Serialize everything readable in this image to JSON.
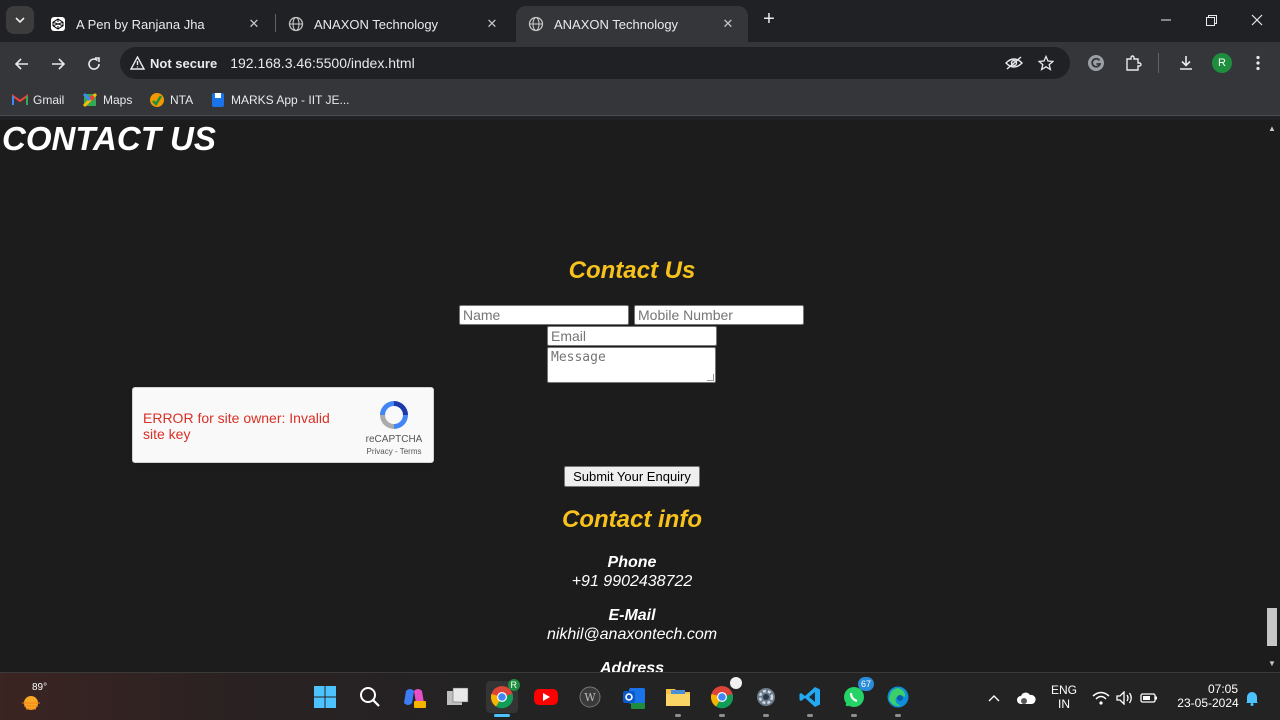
{
  "browser": {
    "tab_search_icon": "chevron-down-icon",
    "tabs": [
      {
        "title": "A Pen by Ranjana Jha",
        "icon": "codepen-icon"
      },
      {
        "title": "ANAXON Technology",
        "icon": "globe-icon"
      },
      {
        "title": "ANAXON Technology",
        "icon": "globe-icon",
        "active": true
      }
    ],
    "new_tab_label": "+",
    "security_label": "Not secure",
    "url": "192.168.3.46:5500/index.html",
    "avatar_letter": "R",
    "bookmarks": [
      {
        "label": "Gmail",
        "icon": "gmail-icon"
      },
      {
        "label": "Maps",
        "icon": "maps-icon"
      },
      {
        "label": "NTA",
        "icon": "nta-icon"
      },
      {
        "label": "MARKS App - IIT JE...",
        "icon": "marks-app-icon"
      }
    ]
  },
  "page": {
    "heading": "CONTACT US",
    "form": {
      "title": "Contact Us",
      "name_placeholder": "Name",
      "mobile_placeholder": "Mobile Number",
      "email_placeholder": "Email",
      "message_placeholder": "Message",
      "submit_label": "Submit Your Enquiry"
    },
    "recaptcha": {
      "error_text": "ERROR for site owner: Invalid site key",
      "brand": "reCAPTCHA",
      "privacy": "Privacy",
      "separator": " - ",
      "terms": "Terms"
    },
    "contact_info": {
      "title": "Contact info",
      "phone_label": "Phone",
      "phone_value": "+91 9902438722",
      "email_label": "E-Mail",
      "email_value": "nikhil@anaxontech.com",
      "address_label": "Address"
    }
  },
  "taskbar": {
    "weather_temp": "89°",
    "whatsapp_badge": "67",
    "lang_line1": "ENG",
    "lang_line2": "IN",
    "time": "07:05",
    "date": "23-05-2024"
  },
  "colors": {
    "accent_yellow": "#f6c21b",
    "page_bg": "#1c1c1c",
    "error_red": "#d93025"
  }
}
